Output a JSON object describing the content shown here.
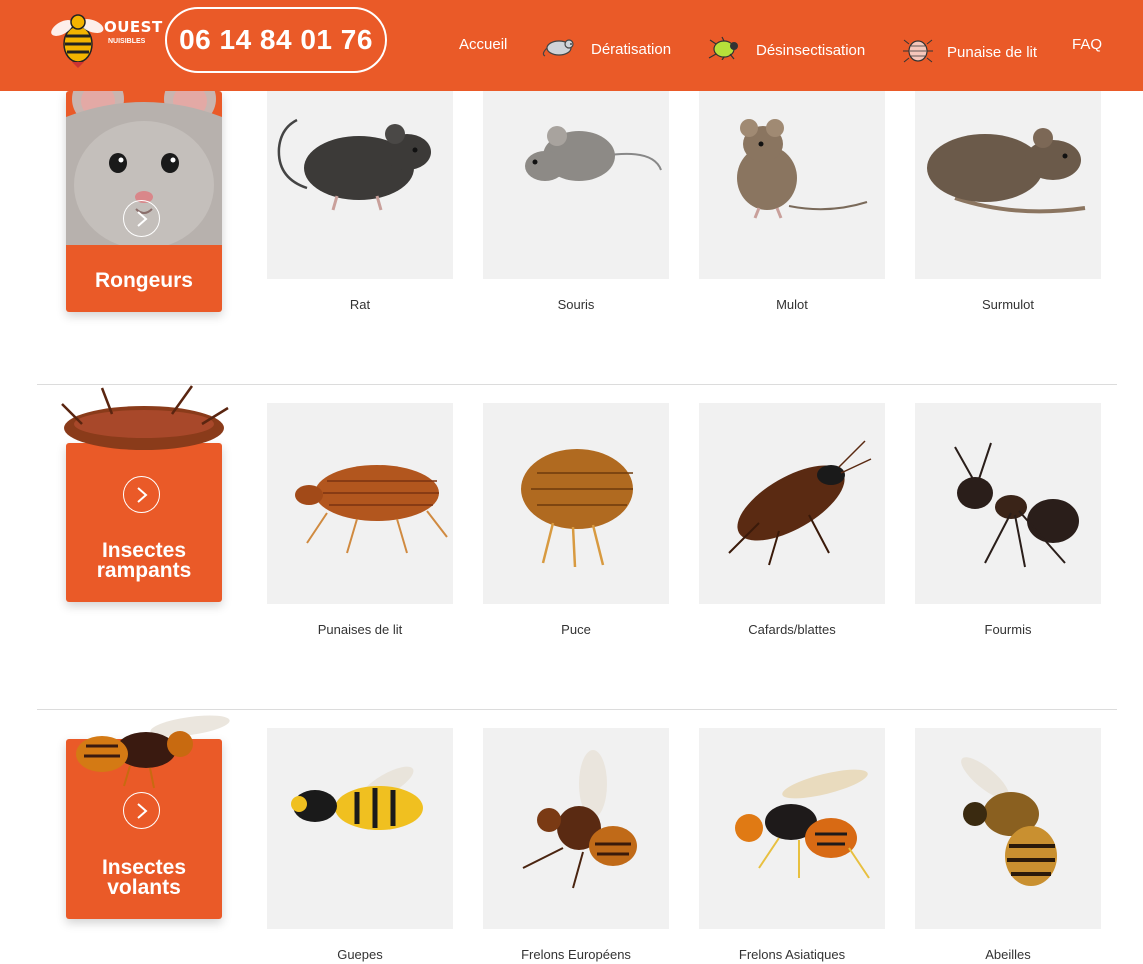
{
  "header": {
    "logo_text": "OUEST",
    "logo_sub": "NUISIBLES",
    "phone": "06 14 84 01 76",
    "nav": [
      {
        "label": "Accueil",
        "icon": ""
      },
      {
        "label": "Dératisation",
        "icon": "rat-icon"
      },
      {
        "label": "Désinsectisation",
        "icon": "bug-icon"
      },
      {
        "label": "Punaise de lit",
        "icon": "bedbug-icon"
      },
      {
        "label": "FAQ",
        "icon": ""
      }
    ]
  },
  "sections": [
    {
      "category": "Rongeurs",
      "items": [
        "Rat",
        "Souris",
        "Mulot",
        "Surmulot"
      ]
    },
    {
      "category_line1": "Insectes",
      "category_line2": "rampants",
      "items": [
        "Punaises de lit",
        "Puce",
        "Cafards/blattes",
        "Fourmis"
      ]
    },
    {
      "category_line1": "Insectes",
      "category_line2": "volants",
      "items": [
        "Guepes",
        "Frelons Européens",
        "Frelons Asiatiques",
        "Abeilles"
      ]
    }
  ],
  "colors": {
    "brand_orange": "#ea5a28",
    "tile_bg": "#f1f1f1",
    "divider": "#dcdcdc"
  }
}
